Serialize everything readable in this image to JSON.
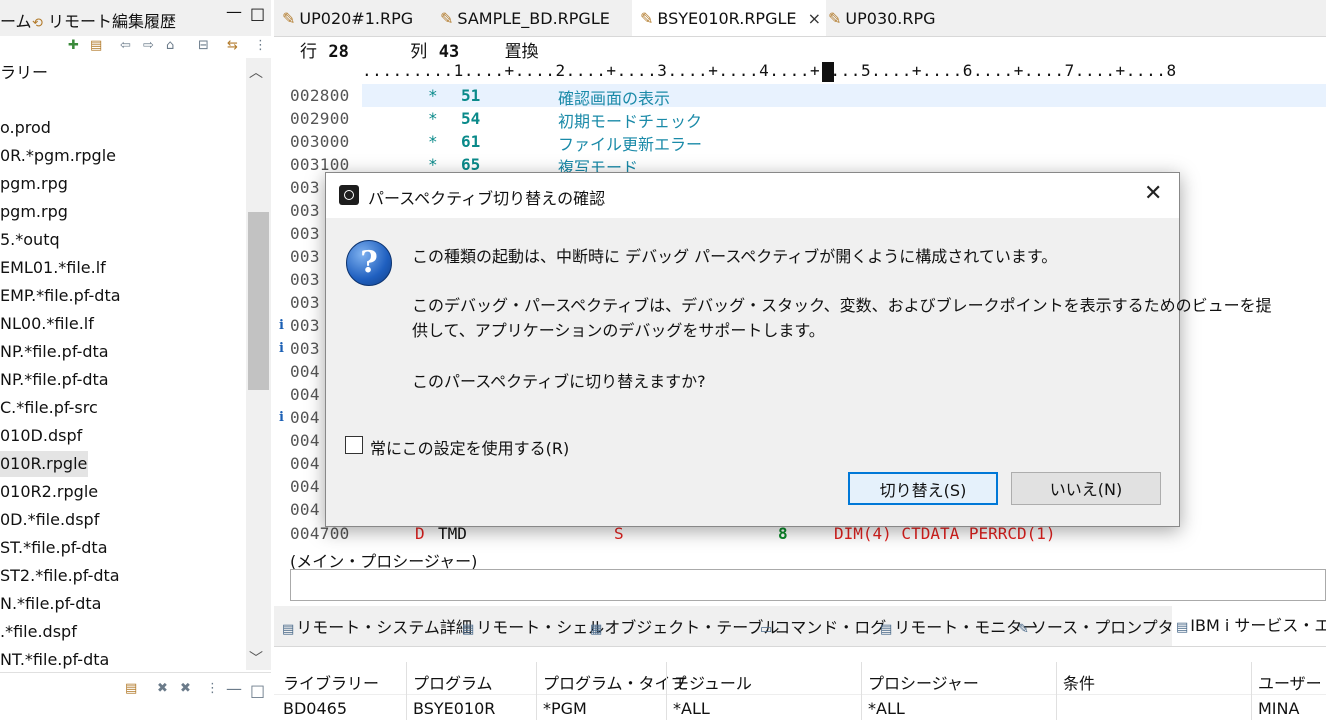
{
  "left_panel": {
    "tabs": [
      "ーム",
      "リモート編集履歴"
    ],
    "min_label": "—",
    "max_label": "□",
    "items": [
      "ラリー",
      "",
      "o.prod",
      "0R.*pgm.rpgle",
      "pgm.rpg",
      "pgm.rpg",
      "5.*outq",
      "EML01.*file.lf",
      "EMP.*file.pf-dta",
      "NL00.*file.lf",
      "NP.*file.pf-dta",
      "NP.*file.pf-dta",
      "C.*file.pf-src",
      "010D.dspf",
      "010R.rpgle",
      "010R2.rpgle",
      "0D.*file.dspf",
      "ST.*file.pf-dta",
      "ST2.*file.pf-dta",
      "N.*file.pf-dta",
      ".*file.dspf",
      "NT.*file.pf-dta"
    ],
    "selected_index": 14
  },
  "editor": {
    "tabs": [
      "UP020#1.RPG",
      "SAMPLE_BD.RPGLE",
      "BSYE010R.RPGLE",
      "UP030.RPG"
    ],
    "active_tab": 2,
    "close_glyph": "×",
    "status": {
      "row_label": "行",
      "row": "28",
      "col_label": "列",
      "col": "43",
      "mode": "置換"
    },
    "ruler": ".........1....+....2....+....3....+....4....+....5....+....6....+....7....+....8",
    "lines": [
      {
        "num": "002800",
        "star": "*",
        "ind": "51",
        "comment": "確認画面の表示"
      },
      {
        "num": "002900",
        "star": "*",
        "ind": "54",
        "comment": "初期モードチェック"
      },
      {
        "num": "003000",
        "star": "*",
        "ind": "61",
        "comment": "ファイル更新エラー"
      },
      {
        "num": "003100",
        "star": "*",
        "ind": "65",
        "comment": "複写モード"
      }
    ],
    "hidden_line_prefixes": [
      "003",
      "003",
      "003",
      "003",
      "003",
      "003",
      "003",
      "003",
      "004",
      "004",
      "004",
      "004",
      "004",
      "004",
      "004"
    ],
    "last_line": {
      "num": "004700",
      "spec": "D",
      "name": "TMD",
      "type": "S",
      "len": "8",
      "keywords": "DIM(4) CTDATA PERRCD(1)"
    },
    "procedure_label": "(メイン・プロシージャー)"
  },
  "bottom_panel": {
    "tabs": [
      "リモート・システム詳細",
      "リモート・シェル",
      "オブジェクト・テーブル",
      "コマンド・ログ",
      "リモート・モニター",
      "ソース・プロンプター",
      "IBM i サービス・エン"
    ],
    "columns": [
      "ライブラリー",
      "プログラム",
      "プログラム・タイプ",
      "モジュール",
      "プロシージャー",
      "条件",
      "ユーザー ID"
    ],
    "row": [
      "BD0465",
      "BSYE010R",
      "*PGM",
      "*ALL",
      "*ALL",
      "",
      "MINA"
    ]
  },
  "dialog": {
    "title": "パースペクティブ切り替えの確認",
    "close_glyph": "✕",
    "question_glyph": "?",
    "message1": "この種類の起動は、中断時に デバッグ パースペクティブが開くように構成されています。",
    "message2a": "このデバッグ・パースペクティブは、デバッグ・スタック、変数、およびブレークポイントを表示するためのビューを提",
    "message2b": "供して、アプリケーションのデバッグをサポートします。",
    "message3": "このパースペクティブに切り替えますか?",
    "checkbox_label": "常にこの設定を使用する(R)",
    "checkbox_checked": false,
    "primary_button": "切り替え(S)",
    "secondary_button": "いいえ(N)"
  },
  "colors": {
    "accent": "#0078d7",
    "comment": "#1a8aa8",
    "indicator": "#0a8a8a",
    "keyword_red": "#e0201e",
    "length_green": "#0a8a2a"
  }
}
